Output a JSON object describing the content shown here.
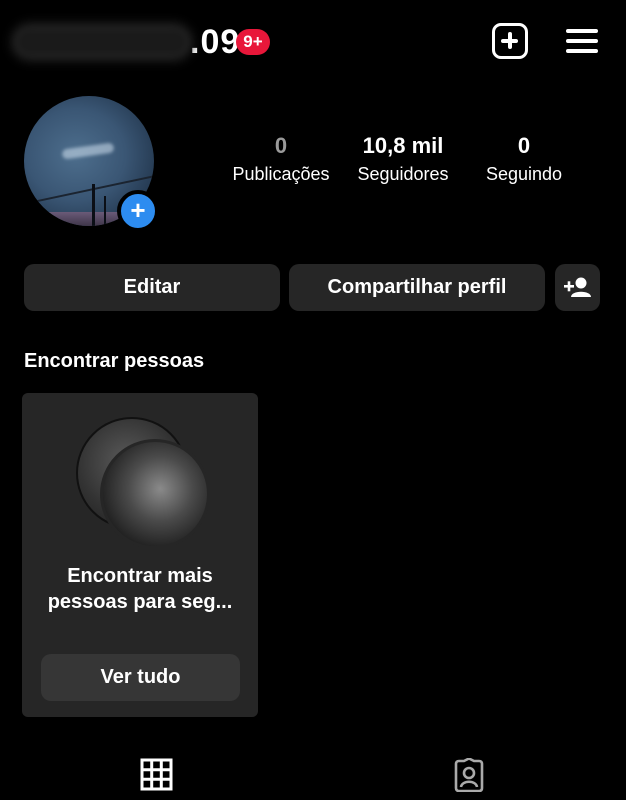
{
  "header": {
    "username_visible": ".09",
    "notification_badge": "9+",
    "icons": [
      "plus-square-icon",
      "hamburger-menu-icon"
    ]
  },
  "profile": {
    "stats": [
      {
        "value": "0",
        "label": "Publicações"
      },
      {
        "value": "10,8 mil",
        "label": "Seguidores"
      },
      {
        "value": "0",
        "label": "Seguindo"
      }
    ]
  },
  "actions": {
    "edit_label": "Editar",
    "share_label": "Compartilhar perfil"
  },
  "discover": {
    "title": "Encontrar pessoas",
    "card": {
      "line1": "Encontrar mais",
      "line2": "pessoas para seg...",
      "button_label": "Ver tudo"
    }
  },
  "tabs": [
    "grid-icon",
    "tagged-icon"
  ],
  "colors": {
    "background": "#000000",
    "button_bg": "#262626",
    "badge": "#e8173a",
    "story_plus": "#2d8cf0"
  }
}
